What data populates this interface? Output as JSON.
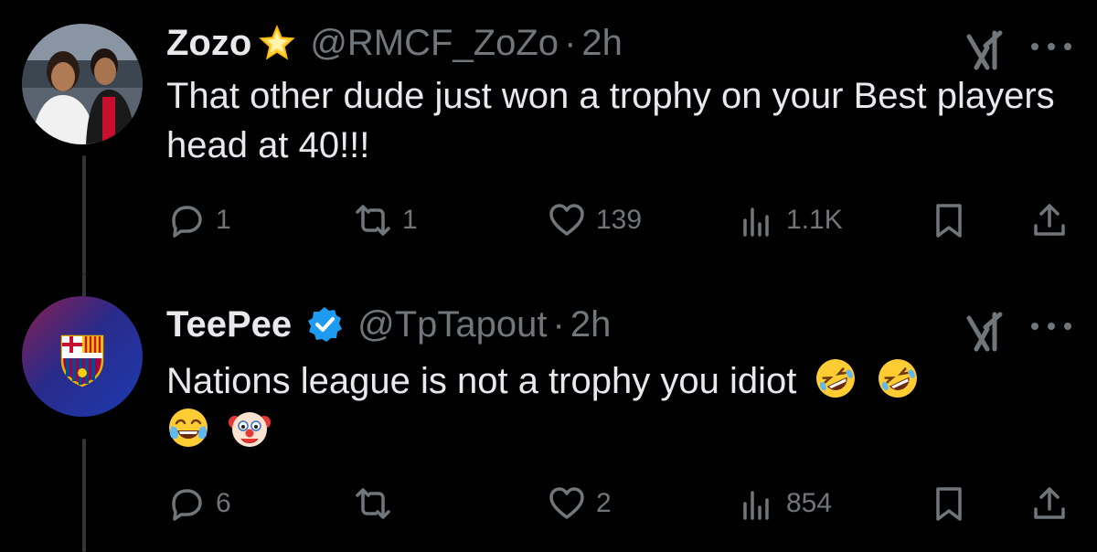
{
  "tweets": [
    {
      "name": "Zozo",
      "handle": "@RMCF_ZoZo",
      "separator": "·",
      "time": "2h",
      "text": "That other dude just won a trophy on your Best players head at 40!!!",
      "badge_icon": "star-emoji-icon",
      "avatar": "photo-avatar",
      "replies": "1",
      "reposts": "1",
      "likes": "139",
      "views": "1.1K"
    },
    {
      "name": "TeePee",
      "handle": "@TpTapout",
      "separator": "·",
      "time": "2h",
      "text": "Nations league is not a trophy you idiot",
      "emojis": [
        "rolling-laughing-emoji",
        "rolling-laughing-emoji",
        "tears-of-joy-emoji",
        "clown-emoji"
      ],
      "badge_icon": "verified-badge-icon",
      "avatar": "fc-barcelona-crest-avatar",
      "replies": "6",
      "reposts": "",
      "likes": "2",
      "views": "854"
    }
  ],
  "colors": {
    "background": "#000000",
    "text": "#e7e9ea",
    "muted": "#71767b",
    "verified": "#1d9bf0",
    "thread_line": "#333639"
  }
}
